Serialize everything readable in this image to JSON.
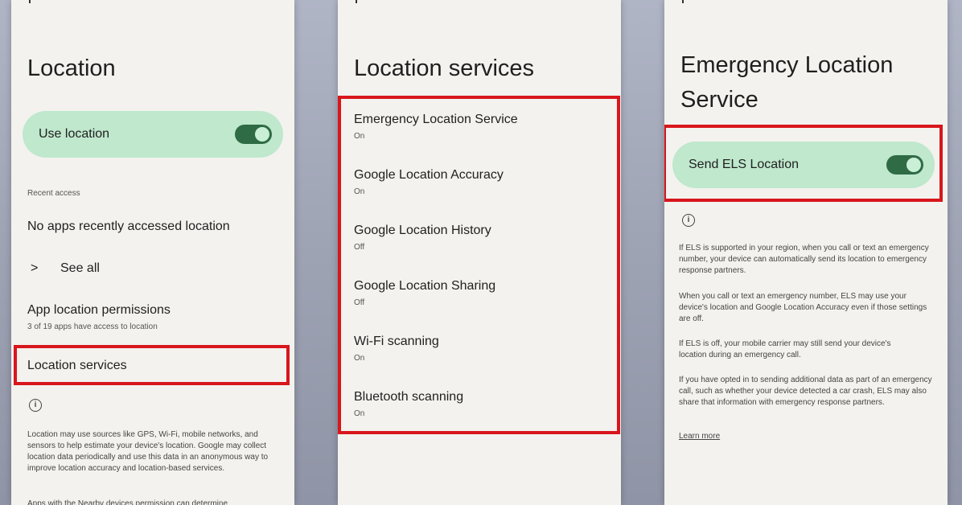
{
  "screen1": {
    "title": "Location",
    "use_location_label": "Use location",
    "recent_access_heading": "Recent access",
    "no_apps_text": "No apps recently accessed location",
    "see_all_chevron": ">",
    "see_all_label": "See all",
    "app_permissions_label": "App location permissions",
    "app_permissions_sub": "3 of 19 apps have access to location",
    "location_services_label": "Location services",
    "info_text": "Location may use sources like GPS, Wi-Fi, mobile networks, and sensors to help estimate your device's location. Google may collect location data periodically and use this data in an anonymous way to improve location accuracy and location-based services.",
    "cut_off_text": "Apps with the Nearby devices permission can determine"
  },
  "screen2": {
    "title": "Location services",
    "items": [
      {
        "label": "Emergency Location Service",
        "status": "On"
      },
      {
        "label": "Google Location Accuracy",
        "status": "On"
      },
      {
        "label": "Google Location History",
        "status": "Off"
      },
      {
        "label": "Google Location Sharing",
        "status": "Off"
      },
      {
        "label": "Wi-Fi scanning",
        "status": "On"
      },
      {
        "label": "Bluetooth scanning",
        "status": "On"
      }
    ]
  },
  "screen3": {
    "title_line1": "Emergency Location",
    "title_line2": "Service",
    "send_els_label": "Send ELS Location",
    "para1": "If ELS is supported in your region, when you call or text an emergency number, your device can automatically send its location to emergency response partners.",
    "para2": "When you call or text an emergency number, ELS may use your device's location and Google Location Accuracy even if those settings are off.",
    "para3": "If ELS is off, your mobile carrier may still send your device's location during an emergency call.",
    "para4": "If you have opted in to sending additional data as part of an emergency call, such as whether your device detected a car crash, ELS may also share that information with emergency response partners.",
    "learn_more": "Learn more"
  },
  "colors": {
    "highlight_red": "#d8161c",
    "pill_green": "#bfe8cd",
    "toggle_green": "#2f6b45",
    "panel_bg": "#f3f2ee"
  },
  "icons": {
    "info": "info-icon",
    "chevron": "chevron-right-icon"
  }
}
